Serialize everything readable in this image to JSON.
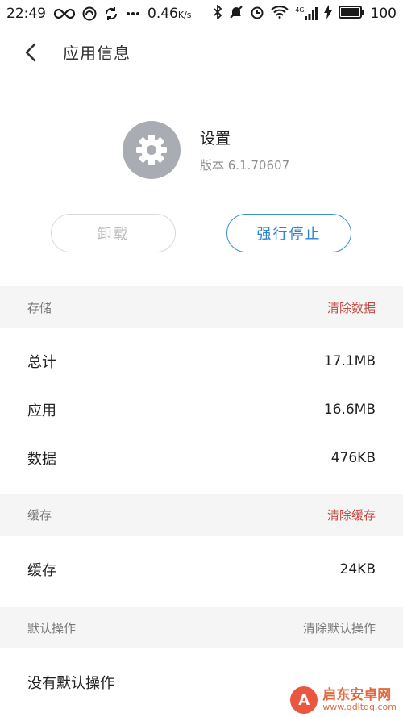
{
  "status_bar": {
    "time": "22:49",
    "speed": "0.46",
    "speed_unit": "K/s",
    "network_label": "4G",
    "battery": "100"
  },
  "titlebar": {
    "title": "应用信息"
  },
  "app": {
    "name": "设置",
    "version": "版本 6.1.70607",
    "icon": "gear-icon"
  },
  "buttons": {
    "uninstall": "卸载",
    "force_stop": "强行停止"
  },
  "storage": {
    "header": "存储",
    "action": "清除数据",
    "rows": [
      {
        "label": "总计",
        "value": "17.1MB"
      },
      {
        "label": "应用",
        "value": "16.6MB"
      },
      {
        "label": "数据",
        "value": "476KB"
      }
    ]
  },
  "cache": {
    "header": "缓存",
    "action": "清除缓存",
    "rows": [
      {
        "label": "缓存",
        "value": "24KB"
      }
    ]
  },
  "defaults": {
    "header": "默认操作",
    "action": "清除默认操作",
    "rows": [
      {
        "label": "没有默认操作"
      }
    ]
  },
  "watermark": {
    "name": "启东安卓网",
    "url": "www.qdltdq.com"
  },
  "colors": {
    "accent_blue": "#2b84cf",
    "action_red": "#c0453c",
    "section_bg": "#f5f5f5"
  }
}
